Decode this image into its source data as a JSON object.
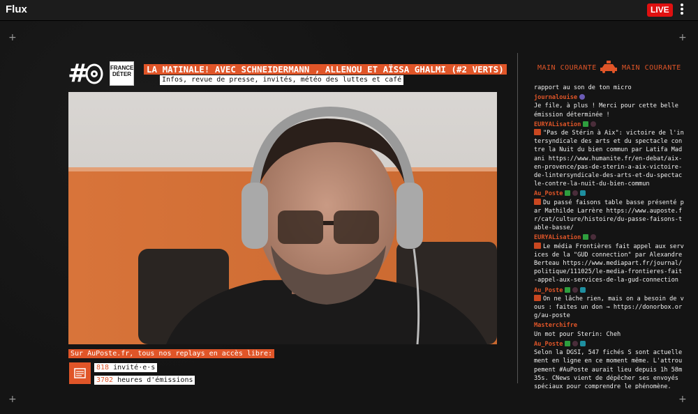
{
  "app": {
    "title": "Flux",
    "live_label": "LIVE"
  },
  "show": {
    "title": "LA MATINALE! AVEC SCHNEIDERMANN , ALLENOU ET AÏSSA GHALMI (#2 VERTS)",
    "subtitle": "Infos, revue de presse, invités, météo des luttes et café",
    "logo_text": "#O",
    "partner_logo": "FRANCE DETER"
  },
  "replays": {
    "label": "Sur AuPoste.fr, tous nos replays en accès libre:",
    "guests_count": "818",
    "guests_label": " invité·e·s",
    "hours_count": "3702",
    "hours_label": " heures d'émissions"
  },
  "main_courante": {
    "left_label": "MAIN COURANTE",
    "right_label": "MAIN COURANTE"
  },
  "chat": [
    {
      "user": "",
      "badges": [],
      "text": "rapport au son de ton micro"
    },
    {
      "user": "journalouise",
      "badges": [
        "purple"
      ],
      "text": "Je file, à plus ! Merci pour cette belle émission déterminée !"
    },
    {
      "user": "EURYALisation",
      "badges": [
        "green",
        "pink"
      ],
      "emote": true,
      "text": "\"Pas de Stérin à Aix\": victoire de l'intersyndicale des arts et du spectacle contre la Nuit du bien commun par Latifa Madani https://www.humanite.fr/en-debat/aix-en-provence/pas-de-sterin-a-aix-victoire-de-lintersyndicale-des-arts-et-du-spectacle-contre-la-nuit-du-bien-commun"
    },
    {
      "user": "Au_Poste",
      "badges": [
        "green",
        "pink",
        "cyan"
      ],
      "emote": true,
      "text": "Du passé faisons table basse présenté par Mathilde Larrère https://www.auposte.fr/cat/culture/histoire/du-passe-faisons-table-basse/"
    },
    {
      "user": "EURYALisation",
      "badges": [
        "green",
        "pink"
      ],
      "emote": true,
      "text": "Le média Frontières fait appel aux services de la \"GUD connection\" par Alexandre Berteau https://www.mediapart.fr/journal/politique/111025/le-media-frontieres-fait-appel-aux-services-de-la-gud-connection"
    },
    {
      "user": "Au_Poste",
      "badges": [
        "green",
        "pink",
        "cyan"
      ],
      "emote": true,
      "text": "On ne lâche rien, mais on a besoin de vous : faites un don → https://donorbox.org/au-poste"
    },
    {
      "user": "Masterchifre",
      "badges": [],
      "text": "Un mot pour Sterin: Cheh"
    },
    {
      "user": "Au_Poste",
      "badges": [
        "green",
        "pink",
        "cyan"
      ],
      "text": "Selon la DGSI, 547 fichés S sont actuellement en ligne en ce moment même. L'attroupement #AuPoste aurait lieu depuis 1h 58m 35s. CNews vient de dépêcher ses envoyés spéciaux pour comprendre le phénomène."
    }
  ],
  "colors": {
    "accent": "#e05528",
    "live": "#e01010",
    "background": "#141414"
  }
}
